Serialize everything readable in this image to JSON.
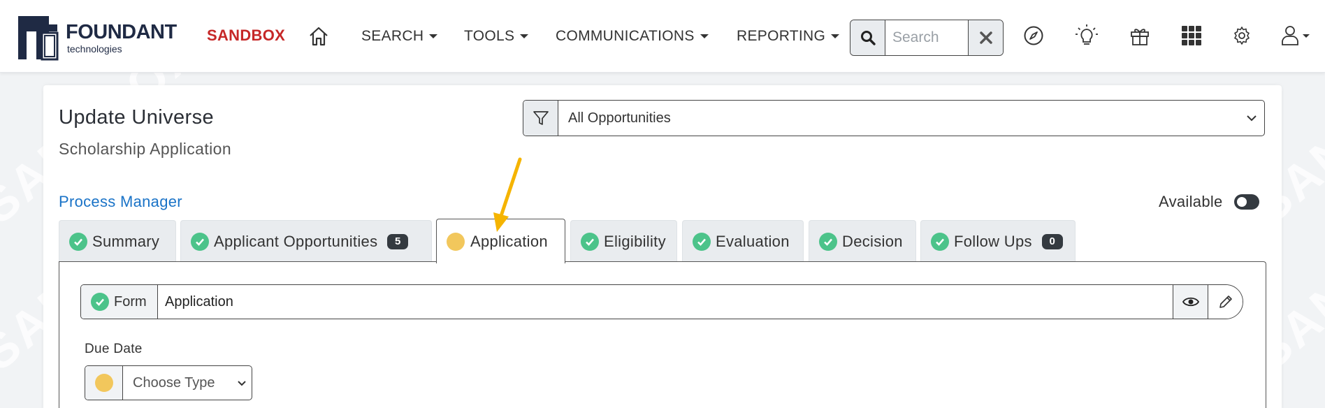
{
  "header": {
    "brand_name": "FOUNDANT",
    "brand_sub": "technologies",
    "env_label": "SANDBOX",
    "nav": [
      {
        "label": "SEARCH"
      },
      {
        "label": "TOOLS"
      },
      {
        "label": "COMMUNICATIONS"
      },
      {
        "label": "REPORTING"
      }
    ],
    "search": {
      "placeholder": "Search",
      "value": ""
    },
    "icons": [
      "home-icon",
      "search-icon",
      "clear-icon",
      "compass-icon",
      "lightbulb-icon",
      "gift-icon",
      "apps-grid-icon",
      "gear-icon",
      "user-icon"
    ]
  },
  "watermark": "SANDBOX",
  "page": {
    "title": "Update Universe",
    "subtitle": "Scholarship Application",
    "opportunity_filter": {
      "selected": "All Opportunities",
      "icon": "filter-icon"
    },
    "process_manager_link": "Process Manager",
    "available_label": "Available",
    "available_on": false
  },
  "tabs": [
    {
      "label": "Summary",
      "status": "complete"
    },
    {
      "label": "Applicant Opportunities",
      "status": "complete",
      "badge": "5"
    },
    {
      "label": "Application",
      "status": "pending",
      "active": true
    },
    {
      "label": "Eligibility",
      "status": "complete"
    },
    {
      "label": "Evaluation",
      "status": "complete"
    },
    {
      "label": "Decision",
      "status": "complete"
    },
    {
      "label": "Follow Ups",
      "status": "complete",
      "badge": "0"
    }
  ],
  "panel": {
    "form": {
      "label": "Form",
      "value": "Application",
      "status": "complete"
    },
    "due_date": {
      "label": "Due Date",
      "selected": "Choose Type",
      "status": "pending"
    }
  },
  "colors": {
    "accent_red": "#c62828",
    "link_blue": "#1a73c7",
    "complete_green": "#4cc38a",
    "pending_yellow": "#f2c75c",
    "arrow_orange": "#f5b400",
    "badge_dark": "#343a40"
  }
}
